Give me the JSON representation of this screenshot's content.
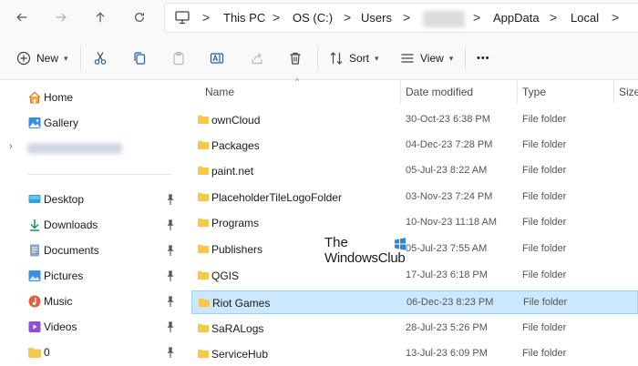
{
  "address_bar": {
    "back_icon": "arrow-left-icon",
    "forward_icon": "arrow-right-icon",
    "up_icon": "arrow-up-icon",
    "refresh_icon": "refresh-icon",
    "computer_icon": "computer-icon",
    "crumbs": [
      "This PC",
      "OS (C:)",
      "Users",
      "AppData",
      "Local"
    ],
    "separator": ">"
  },
  "toolbar": {
    "new_label": "New",
    "sort_label": "Sort",
    "view_label": "View",
    "more_label": "•••",
    "icons": [
      "plus-icon",
      "cut-icon",
      "copy-icon",
      "paste-icon",
      "rename-icon",
      "share-icon",
      "delete-icon",
      "sort-icon",
      "view-icon",
      "more-icon"
    ]
  },
  "sidebar": {
    "top_items": [
      {
        "label": "Home",
        "icon": "home-icon"
      },
      {
        "label": "Gallery",
        "icon": "gallery-icon"
      }
    ],
    "pinned_items": [
      {
        "label": "Desktop",
        "icon": "desktop-icon"
      },
      {
        "label": "Downloads",
        "icon": "downloads-icon"
      },
      {
        "label": "Documents",
        "icon": "documents-icon"
      },
      {
        "label": "Pictures",
        "icon": "pictures-icon"
      },
      {
        "label": "Music",
        "icon": "music-icon"
      },
      {
        "label": "Videos",
        "icon": "videos-icon"
      },
      {
        "label": "0",
        "icon": "folder-icon"
      }
    ]
  },
  "file_list": {
    "columns": [
      "Name",
      "Date modified",
      "Type",
      "Size"
    ],
    "rows": [
      {
        "name": "ownCloud",
        "date": "30-Oct-23 6:38 PM",
        "type": "File folder"
      },
      {
        "name": "Packages",
        "date": "04-Dec-23 7:28 PM",
        "type": "File folder"
      },
      {
        "name": "paint.net",
        "date": "05-Jul-23 8:22 AM",
        "type": "File folder"
      },
      {
        "name": "PlaceholderTileLogoFolder",
        "date": "03-Nov-23 7:24 PM",
        "type": "File folder"
      },
      {
        "name": "Programs",
        "date": "10-Nov-23 11:18 AM",
        "type": "File folder"
      },
      {
        "name": "Publishers",
        "date": "05-Jul-23 7:55 AM",
        "type": "File folder"
      },
      {
        "name": "QGIS",
        "date": "17-Jul-23 6:18 PM",
        "type": "File folder"
      },
      {
        "name": "Riot Games",
        "date": "06-Dec-23 8:23 PM",
        "type": "File folder",
        "selected": true
      },
      {
        "name": "SaRALogs",
        "date": "28-Jul-23 5:26 PM",
        "type": "File folder"
      },
      {
        "name": "ServiceHub",
        "date": "13-Jul-23 6:09 PM",
        "type": "File folder"
      }
    ]
  },
  "watermark": {
    "line1": "The",
    "line2": "WindowsClub"
  },
  "colors": {
    "accent": "#0067c0",
    "folder": "#f8c84a",
    "selection": "#cce8ff"
  }
}
